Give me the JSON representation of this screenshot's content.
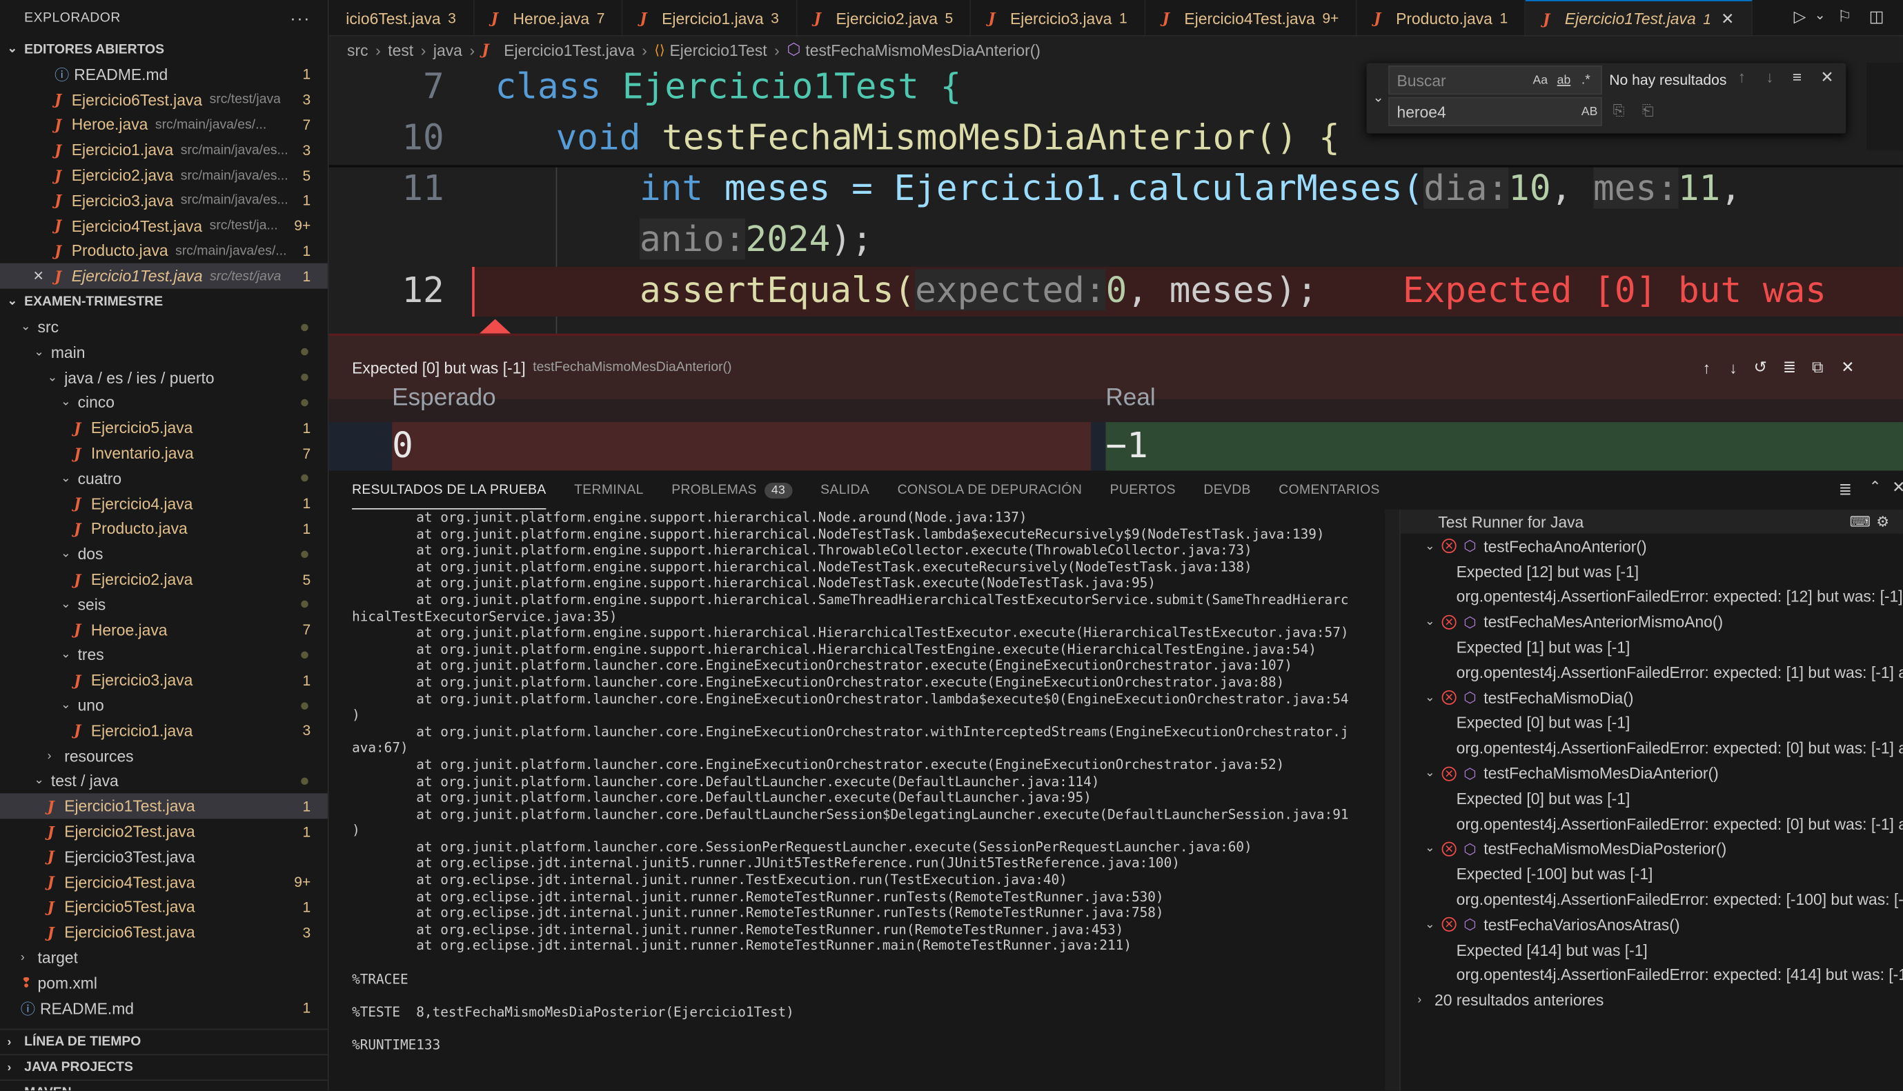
{
  "sidebar": {
    "title": "EXPLORADOR",
    "open_editors_title": "EDITORES ABIERTOS",
    "open_editors": [
      {
        "label": "README.md",
        "path": "",
        "badge": "1",
        "kind": "info"
      },
      {
        "label": "Ejercicio6Test.java",
        "path": "src/test/java",
        "badge": "3"
      },
      {
        "label": "Heroe.java",
        "path": "src/main/java/es/...",
        "badge": "7"
      },
      {
        "label": "Ejercicio1.java",
        "path": "src/main/java/es...",
        "badge": "3"
      },
      {
        "label": "Ejercicio2.java",
        "path": "src/main/java/es...",
        "badge": "5"
      },
      {
        "label": "Ejercicio3.java",
        "path": "src/main/java/es...",
        "badge": "1"
      },
      {
        "label": "Ejercicio4Test.java",
        "path": "src/test/ja...",
        "badge": "9+"
      },
      {
        "label": "Producto.java",
        "path": "src/main/java/es/...",
        "badge": "1"
      },
      {
        "label": "Ejercicio1Test.java",
        "path": "src/test/java",
        "badge": "1",
        "active": true
      }
    ],
    "project_title": "EXAMEN-TRIMESTRE",
    "tree": [
      {
        "label": "src",
        "indent": 1,
        "folder": true,
        "open": true,
        "dot": true
      },
      {
        "label": "main",
        "indent": 2,
        "folder": true,
        "open": true,
        "dot": true
      },
      {
        "label": "java / es / ies / puerto",
        "indent": 3,
        "folder": true,
        "open": true,
        "dot": true
      },
      {
        "label": "cinco",
        "indent": 4,
        "folder": true,
        "open": true,
        "dot": true
      },
      {
        "label": "Ejercicio5.java",
        "indent": 5,
        "badge": "1"
      },
      {
        "label": "Inventario.java",
        "indent": 5,
        "badge": "7"
      },
      {
        "label": "cuatro",
        "indent": 4,
        "folder": true,
        "open": true,
        "dot": true
      },
      {
        "label": "Ejercicio4.java",
        "indent": 5,
        "badge": "1"
      },
      {
        "label": "Producto.java",
        "indent": 5,
        "badge": "1"
      },
      {
        "label": "dos",
        "indent": 4,
        "folder": true,
        "open": true,
        "dot": true
      },
      {
        "label": "Ejercicio2.java",
        "indent": 5,
        "badge": "5"
      },
      {
        "label": "seis",
        "indent": 4,
        "folder": true,
        "open": true,
        "dot": true
      },
      {
        "label": "Heroe.java",
        "indent": 5,
        "badge": "7"
      },
      {
        "label": "tres",
        "indent": 4,
        "folder": true,
        "open": true,
        "dot": true
      },
      {
        "label": "Ejercicio3.java",
        "indent": 5,
        "badge": "1"
      },
      {
        "label": "uno",
        "indent": 4,
        "folder": true,
        "open": true,
        "dot": true
      },
      {
        "label": "Ejercicio1.java",
        "indent": 5,
        "badge": "3"
      },
      {
        "label": "resources",
        "indent": 3,
        "folder": true,
        "open": false
      },
      {
        "label": "test / java",
        "indent": 2,
        "folder": true,
        "open": true,
        "dot": true
      },
      {
        "label": "Ejercicio1Test.java",
        "indent": 3,
        "badge": "1",
        "selected": true
      },
      {
        "label": "Ejercicio2Test.java",
        "indent": 3,
        "badge": "1"
      },
      {
        "label": "Ejercicio3Test.java",
        "indent": 3,
        "badge": "",
        "plain": true
      },
      {
        "label": "Ejercicio4Test.java",
        "indent": 3,
        "badge": "9+"
      },
      {
        "label": "Ejercicio5Test.java",
        "indent": 3,
        "badge": "1"
      },
      {
        "label": "Ejercicio6Test.java",
        "indent": 3,
        "badge": "3"
      },
      {
        "label": "target",
        "indent": 1,
        "folder": true,
        "open": false
      },
      {
        "label": "pom.xml",
        "indent": 1,
        "badge": "",
        "xml": true
      },
      {
        "label": "README.md",
        "indent": 1,
        "badge": "1",
        "info": true
      }
    ],
    "bottom_sections": [
      "LÍNEA DE TIEMPO",
      "JAVA PROJECTS",
      "MAVEN"
    ]
  },
  "tabs": [
    {
      "label": "icio6Test.java",
      "num": "3"
    },
    {
      "label": "Heroe.java",
      "num": "7"
    },
    {
      "label": "Ejercicio1.java",
      "num": "3"
    },
    {
      "label": "Ejercicio2.java",
      "num": "5"
    },
    {
      "label": "Ejercicio3.java",
      "num": "1"
    },
    {
      "label": "Ejercicio4Test.java",
      "num": "9+"
    },
    {
      "label": "Producto.java",
      "num": "1"
    },
    {
      "label": "Ejercicio1Test.java",
      "num": "1",
      "active": true
    }
  ],
  "breadcrumb": [
    "src",
    "test",
    "java",
    "Ejercicio1Test.java",
    "Ejercicio1Test",
    "testFechaMismoMesDiaAnterior()"
  ],
  "editor": {
    "l7": "7",
    "l10": "10",
    "l11": "11",
    "l12": "12",
    "class_kw": "class",
    "class_name": "Ejercicio1Test {",
    "void_kw": "void",
    "method": "testFechaMismoMesDiaAnterior() {",
    "int_kw": "int",
    "meses_assign": "meses = ",
    "call": "Ejercicio1.calcularMeses(",
    "h_dia": "dia:",
    "v_dia": "10",
    "h_mes": "mes:",
    "v_mes": "11",
    "h_anio": "anio:",
    "v_anio": "2024",
    "close": ");",
    "assert": "assertEquals(",
    "h_expected": "expected:",
    "v_expected": "0",
    "assert_rest": ", meses);",
    "inline_error": "Expected [0] but was"
  },
  "find": {
    "search_placeholder": "Buscar",
    "no_results": "No hay resultados",
    "replace_value": "heroe4",
    "aa": "Aa",
    "ab": "ab",
    "regex": ".*",
    "ab2": "AB"
  },
  "peek": {
    "title": "Expected [0] but was [-1]",
    "subtitle": "testFechaMismoMesDiaAnterior()",
    "expected_label": "Esperado",
    "actual_label": "Real",
    "expected_value": "0",
    "actual_value": "−1"
  },
  "panel": {
    "tabs": [
      "RESULTADOS DE LA PRUEBA",
      "TERMINAL",
      "PROBLEMAS",
      "SALIDA",
      "CONSOLA DE DEPURACIÓN",
      "PUERTOS",
      "DEVDB",
      "COMENTARIOS"
    ],
    "problems_count": "43"
  },
  "terminal_lines": [
    "        at org.junit.platform.engine.support.hierarchical.Node.around(Node.java:137)",
    "        at org.junit.platform.engine.support.hierarchical.NodeTestTask.lambda$executeRecursively$9(NodeTestTask.java:139)",
    "        at org.junit.platform.engine.support.hierarchical.ThrowableCollector.execute(ThrowableCollector.java:73)",
    "        at org.junit.platform.engine.support.hierarchical.NodeTestTask.executeRecursively(NodeTestTask.java:138)",
    "        at org.junit.platform.engine.support.hierarchical.NodeTestTask.execute(NodeTestTask.java:95)",
    "        at org.junit.platform.engine.support.hierarchical.SameThreadHierarchicalTestExecutorService.submit(SameThreadHierarc",
    "hicalTestExecutorService.java:35)",
    "        at org.junit.platform.engine.support.hierarchical.HierarchicalTestExecutor.execute(HierarchicalTestExecutor.java:57)",
    "        at org.junit.platform.engine.support.hierarchical.HierarchicalTestEngine.execute(HierarchicalTestEngine.java:54)",
    "        at org.junit.platform.launcher.core.EngineExecutionOrchestrator.execute(EngineExecutionOrchestrator.java:107)",
    "        at org.junit.platform.launcher.core.EngineExecutionOrchestrator.execute(EngineExecutionOrchestrator.java:88)",
    "        at org.junit.platform.launcher.core.EngineExecutionOrchestrator.lambda$execute$0(EngineExecutionOrchestrator.java:54",
    ")",
    "        at org.junit.platform.launcher.core.EngineExecutionOrchestrator.withInterceptedStreams(EngineExecutionOrchestrator.j",
    "ava:67)",
    "        at org.junit.platform.launcher.core.EngineExecutionOrchestrator.execute(EngineExecutionOrchestrator.java:52)",
    "        at org.junit.platform.launcher.core.DefaultLauncher.execute(DefaultLauncher.java:114)",
    "        at org.junit.platform.launcher.core.DefaultLauncher.execute(DefaultLauncher.java:95)",
    "        at org.junit.platform.launcher.core.DefaultLauncherSession$DelegatingLauncher.execute(DefaultLauncherSession.java:91",
    ")",
    "        at org.junit.platform.launcher.core.SessionPerRequestLauncher.execute(SessionPerRequestLauncher.java:60)",
    "        at org.eclipse.jdt.internal.junit5.runner.JUnit5TestReference.run(JUnit5TestReference.java:100)",
    "        at org.eclipse.jdt.internal.junit.runner.TestExecution.run(TestExecution.java:40)",
    "        at org.eclipse.jdt.internal.junit.runner.RemoteTestRunner.runTests(RemoteTestRunner.java:530)",
    "        at org.eclipse.jdt.internal.junit.runner.RemoteTestRunner.runTests(RemoteTestRunner.java:758)",
    "        at org.eclipse.jdt.internal.junit.runner.RemoteTestRunner.run(RemoteTestRunner.java:453)",
    "        at org.eclipse.jdt.internal.junit.runner.RemoteTestRunner.main(RemoteTestRunner.java:211)",
    "",
    "%TRACEE",
    "",
    "%TESTE  8,testFechaMismoMesDiaPosterior(Ejercicio1Test)",
    "",
    "%RUNTIME133"
  ],
  "runner": {
    "title": "Test Runner for Java",
    "tests": [
      {
        "name": "testFechaAnoAnterior()",
        "msg": "Expected [12] but was [-1]",
        "err": "org.opentest4j.AssertionFailedError: expected: [12] but was: [-1]"
      },
      {
        "name": "testFechaMesAnteriorMismoAno()",
        "msg": "Expected [1] but was [-1]",
        "err": "org.opentest4j.AssertionFailedError: expected: [1] but was: [-1] a"
      },
      {
        "name": "testFechaMismoDia()",
        "msg": "Expected [0] but was [-1]",
        "err": "org.opentest4j.AssertionFailedError: expected: [0] but was: [-1] a"
      },
      {
        "name": "testFechaMismoMesDiaAnterior()",
        "msg": "Expected [0] but was [-1]",
        "err": "org.opentest4j.AssertionFailedError: expected: [0] but was: [-1] a"
      },
      {
        "name": "testFechaMismoMesDiaPosterior()",
        "msg": "Expected [-100] but was [-1]",
        "err": "org.opentest4j.AssertionFailedError: expected: [-100] but was: [-"
      },
      {
        "name": "testFechaVariosAnosAtras()",
        "msg": "Expected [414] but was [-1]",
        "err": "org.opentest4j.AssertionFailedError: expected: [414] but was: [-1"
      }
    ],
    "previous_results": "20 resultados anteriores"
  }
}
